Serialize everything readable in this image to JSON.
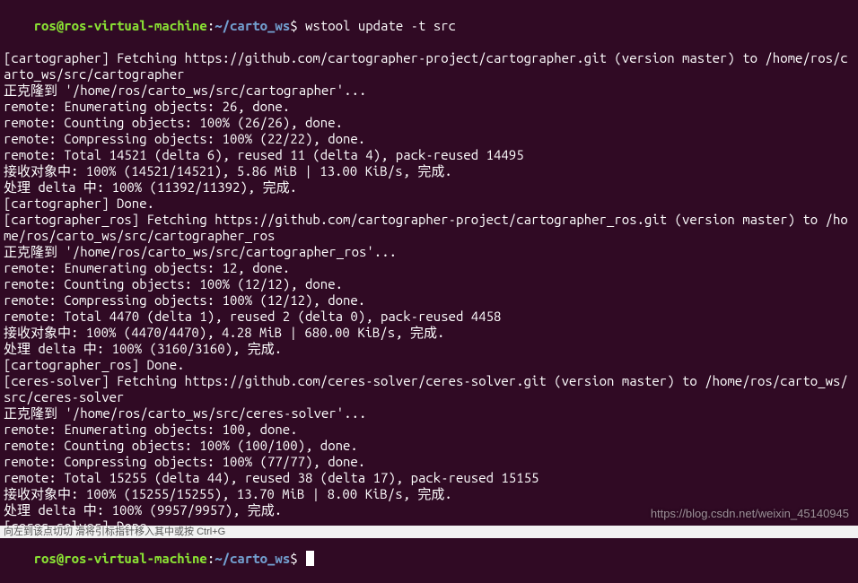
{
  "prompt": {
    "user": "ros",
    "at": "@",
    "host": "ros-virtual-machine",
    "colon": ":",
    "path": "~/carto_ws",
    "dollar": "$"
  },
  "command": " wstool update -t src",
  "lines": [
    "[cartographer] Fetching https://github.com/cartographer-project/cartographer.git (version master) to /home/ros/carto_ws/src/cartographer",
    "正克隆到 '/home/ros/carto_ws/src/cartographer'...",
    "remote: Enumerating objects: 26, done.",
    "remote: Counting objects: 100% (26/26), done.",
    "remote: Compressing objects: 100% (22/22), done.",
    "remote: Total 14521 (delta 6), reused 11 (delta 4), pack-reused 14495",
    "接收对象中: 100% (14521/14521), 5.86 MiB | 13.00 KiB/s, 完成.",
    "处理 delta 中: 100% (11392/11392), 完成.",
    "[cartographer] Done.",
    "[cartographer_ros] Fetching https://github.com/cartographer-project/cartographer_ros.git (version master) to /home/ros/carto_ws/src/cartographer_ros",
    "正克隆到 '/home/ros/carto_ws/src/cartographer_ros'...",
    "remote: Enumerating objects: 12, done.",
    "remote: Counting objects: 100% (12/12), done.",
    "remote: Compressing objects: 100% (12/12), done.",
    "remote: Total 4470 (delta 1), reused 2 (delta 0), pack-reused 4458",
    "接收对象中: 100% (4470/4470), 4.28 MiB | 680.00 KiB/s, 完成.",
    "处理 delta 中: 100% (3160/3160), 完成.",
    "[cartographer_ros] Done.",
    "[ceres-solver] Fetching https://github.com/ceres-solver/ceres-solver.git (version master) to /home/ros/carto_ws/src/ceres-solver",
    "正克隆到 '/home/ros/carto_ws/src/ceres-solver'...",
    "remote: Enumerating objects: 100, done.",
    "remote: Counting objects: 100% (100/100), done.",
    "remote: Compressing objects: 100% (77/77), done.",
    "remote: Total 15255 (delta 44), reused 38 (delta 17), pack-reused 15155",
    "接收对象中: 100% (15255/15255), 13.70 MiB | 8.00 KiB/s, 完成.",
    "处理 delta 中: 100% (9957/9957), 完成.",
    "[ceres-solver] Done."
  ],
  "watermark": "https://blog.csdn.net/weixin_45140945",
  "cut_text": "向左到该点切切    滑将引标指针移入其中或按 Ctrl+G"
}
